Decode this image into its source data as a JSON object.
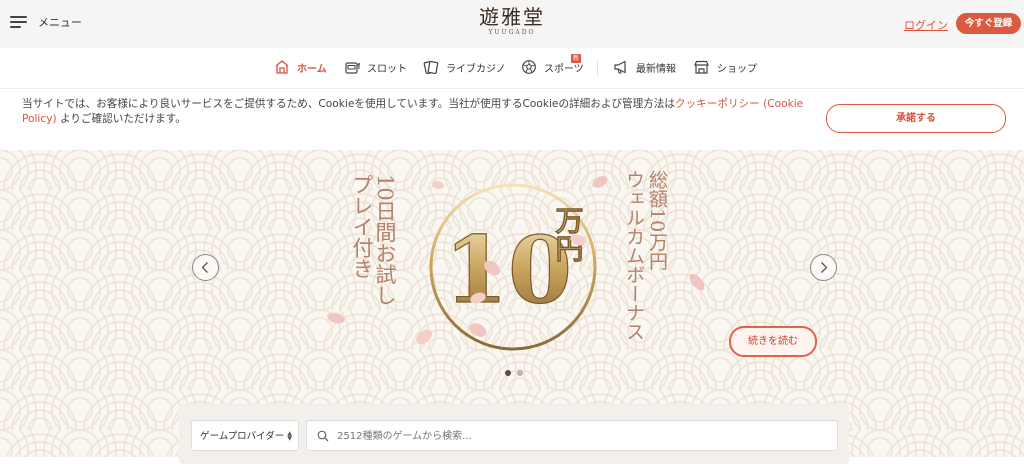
{
  "header": {
    "menu_label": "メニュー",
    "logo_main": "遊雅堂",
    "logo_sub": "YUUGADO",
    "login_label": "ログイン",
    "register_label": "今すぐ登録"
  },
  "nav": {
    "items": [
      {
        "label": "ホーム",
        "icon": "home-icon",
        "active": true
      },
      {
        "label": "スロット",
        "icon": "slot-machine-icon",
        "active": false
      },
      {
        "label": "ライブカジノ",
        "icon": "cards-icon",
        "active": false
      },
      {
        "label": "スポーツ",
        "icon": "soccer-ball-icon",
        "active": false,
        "badge": "新"
      },
      {
        "label": "最新情報",
        "icon": "megaphone-icon",
        "active": false
      },
      {
        "label": "ショップ",
        "icon": "shop-icon",
        "active": false
      }
    ]
  },
  "cookie": {
    "text_before": "当サイトでは、お客様により良いサービスをご提供するため、Cookieを使用しています。当社が使用するCookieの詳細および管理方法は",
    "link_label": "クッキーポリシー (Cookie Policy)",
    "text_after": " よりご確認いただけます。",
    "accept_label": "承諾する"
  },
  "banner": {
    "left_line1": "10日間お試し",
    "left_line2": "プレイ付き",
    "big_number": "10",
    "unit": "万円",
    "right_line1": "総額10万円",
    "right_line2": "ウェルカムボーナス",
    "read_more_label": "続きを読む",
    "slide_count": 2,
    "active_slide": 1
  },
  "search": {
    "provider_label": "ゲームプロバイダー",
    "placeholder": "2512種類のゲームから検索..."
  },
  "colors": {
    "accent": "#dc5a3f",
    "header_bg": "#f7f5f3",
    "hero_bg": "#faf7f2",
    "gold": "#c9a35d"
  }
}
